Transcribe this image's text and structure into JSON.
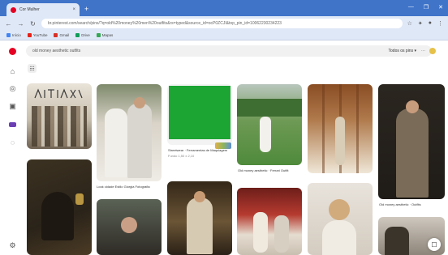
{
  "browser": {
    "tab_title": "Cor Mulher",
    "tab_close": "×",
    "new_tab": "+",
    "window_controls": [
      "—",
      "❐",
      "✕"
    ],
    "url": "br.pinterest.com/search/pins/?q=old%20money%20men%20outfits&rs=typed&source_id=ocP0ZCJI&top_pin_id=10062230234223",
    "bookmarks": [
      "Início",
      "YouTube",
      "Gmail",
      "Drive",
      "Mapas"
    ]
  },
  "pinterest": {
    "search_query": "old money aesthetic outfits",
    "tool_primary": "Todos os pins ▾",
    "tool_more": "⋯",
    "filter_icon": "☷",
    "pins": [
      {
        "caption": ""
      },
      {
        "caption": "Look cidade Estilo Giorgia Fotografia"
      },
      {
        "caption": "Streetwear  · Ferramentas de Maquiagem"
      },
      {
        "caption": "Old money aesthetic · Ferrari Outfit"
      },
      {
        "caption": ""
      },
      {
        "caption": "Old money aesthetic · Outfits"
      }
    ],
    "green_pin_meta": "Fundo 1,50 x 2,10"
  },
  "colors": {
    "brand": "#e60023",
    "tabbar": "#3f74c9"
  }
}
